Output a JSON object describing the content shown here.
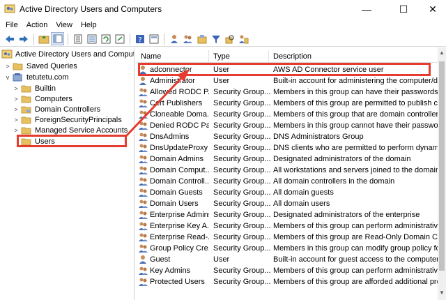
{
  "window": {
    "title": "Active Directory Users and Computers",
    "controls": {
      "minimize": "—",
      "maximize": "☐",
      "close": "✕"
    }
  },
  "menu": [
    "File",
    "Action",
    "View",
    "Help"
  ],
  "toolbar": {
    "buttons": [
      "back-icon",
      "forward-icon",
      "up-folder-icon",
      "console-tree-icon",
      "properties-icon",
      "details-icon",
      "refresh-icon",
      "export-icon",
      "help-icon",
      "list-view-icon",
      "new-user-icon",
      "new-group-icon",
      "new-ou-icon",
      "filter-icon",
      "find-icon",
      "add-to-group-icon"
    ]
  },
  "tree": {
    "root": "Active Directory Users and Computers",
    "saved_queries": "Saved Queries",
    "domain": "tetutetu.com",
    "children": [
      "Builtin",
      "Computers",
      "Domain Controllers",
      "ForeignSecurityPrincipals",
      "Managed Service Accounts",
      "Users"
    ],
    "selected": "Users"
  },
  "list": {
    "columns": {
      "name": "Name",
      "type": "Type",
      "description": "Description"
    },
    "rows": [
      {
        "name": "adconnector",
        "type": "User",
        "description": "AWS AD Connector service user",
        "icon": "user"
      },
      {
        "name": "Administrator",
        "type": "User",
        "description": "Built-in account for administering the computer/do",
        "icon": "user"
      },
      {
        "name": "Allowed RODC P...",
        "type": "Security Group...",
        "description": "Members in this group can have their passwords rep",
        "icon": "group"
      },
      {
        "name": "Cert Publishers",
        "type": "Security Group...",
        "description": "Members of this group are permitted to publish cert",
        "icon": "group"
      },
      {
        "name": "Cloneable Doma...",
        "type": "Security Group...",
        "description": "Members of this group that are domain controllers .",
        "icon": "group"
      },
      {
        "name": "Denied RODC Pa...",
        "type": "Security Group...",
        "description": "Members in this group cannot have their passwords",
        "icon": "group"
      },
      {
        "name": "DnsAdmins",
        "type": "Security Group...",
        "description": "DNS Administrators Group",
        "icon": "group"
      },
      {
        "name": "DnsUpdateProxy",
        "type": "Security Group...",
        "description": "DNS clients who are permitted to perform dynamic",
        "icon": "group"
      },
      {
        "name": "Domain Admins",
        "type": "Security Group...",
        "description": "Designated administrators of the domain",
        "icon": "group"
      },
      {
        "name": "Domain Comput...",
        "type": "Security Group...",
        "description": "All workstations and servers joined to the domain",
        "icon": "group"
      },
      {
        "name": "Domain Controll...",
        "type": "Security Group...",
        "description": "All domain controllers in the domain",
        "icon": "group"
      },
      {
        "name": "Domain Guests",
        "type": "Security Group...",
        "description": "All domain guests",
        "icon": "group"
      },
      {
        "name": "Domain Users",
        "type": "Security Group...",
        "description": "All domain users",
        "icon": "group"
      },
      {
        "name": "Enterprise Admins",
        "type": "Security Group...",
        "description": "Designated administrators of the enterprise",
        "icon": "group"
      },
      {
        "name": "Enterprise Key A...",
        "type": "Security Group...",
        "description": "Members of this group can perform administrative a",
        "icon": "group"
      },
      {
        "name": "Enterprise Read-...",
        "type": "Security Group...",
        "description": "Members of this group are Read-Only Domain Cont",
        "icon": "group"
      },
      {
        "name": "Group Policy Cre...",
        "type": "Security Group...",
        "description": "Members in this group can modify group policy for",
        "icon": "group"
      },
      {
        "name": "Guest",
        "type": "User",
        "description": "Built-in account for guest access to the computer/d",
        "icon": "user"
      },
      {
        "name": "Key Admins",
        "type": "Security Group...",
        "description": "Members of this group can perform administrative a",
        "icon": "group"
      },
      {
        "name": "Protected Users",
        "type": "Security Group...",
        "description": "Members of this group are afforded additional prote",
        "icon": "group"
      }
    ]
  },
  "colors": {
    "highlight": "#e53c2f",
    "folder": "#e8c060"
  }
}
